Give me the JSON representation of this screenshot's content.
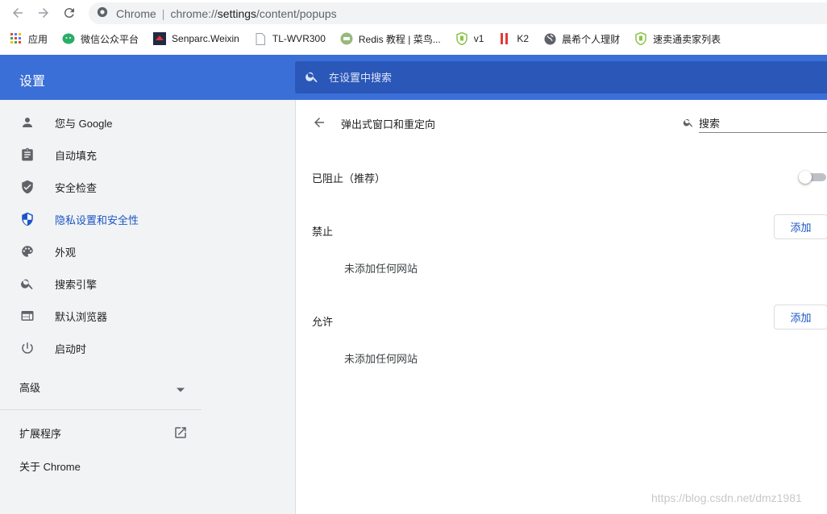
{
  "toolbar": {
    "back_icon": "arrow-left-icon",
    "forward_icon": "arrow-right-icon",
    "reload_icon": "reload-icon",
    "site_name": "Chrome",
    "url_prefix": "chrome://",
    "url_host": "settings",
    "url_path": "/content/popups"
  },
  "bookmarks": [
    {
      "label": "应用",
      "icon": "apps-grid-icon"
    },
    {
      "label": "微信公众平台",
      "icon": "wechat-icon"
    },
    {
      "label": "Senparc.Weixin",
      "icon": "senparc-icon"
    },
    {
      "label": "TL-WVR300",
      "icon": "page-icon"
    },
    {
      "label": "Redis 教程 | 菜鸟...",
      "icon": "runoob-icon"
    },
    {
      "label": "v1",
      "icon": "shield-green-icon"
    },
    {
      "label": "K2",
      "icon": "k2-icon"
    },
    {
      "label": "晨希个人理财",
      "icon": "globe-icon"
    },
    {
      "label": "速卖通卖家列表",
      "icon": "shield-green-icon"
    }
  ],
  "header": {
    "title": "设置",
    "search_placeholder": "在设置中搜索"
  },
  "sidebar": {
    "items": [
      {
        "label": "您与 Google",
        "icon": "person-icon"
      },
      {
        "label": "自动填充",
        "icon": "clipboard-icon"
      },
      {
        "label": "安全检查",
        "icon": "shield-check-icon"
      },
      {
        "label": "隐私设置和安全性",
        "icon": "shield-privacy-icon",
        "active": true
      },
      {
        "label": "外观",
        "icon": "palette-icon"
      },
      {
        "label": "搜索引擎",
        "icon": "search-icon"
      },
      {
        "label": "默认浏览器",
        "icon": "browser-window-icon"
      },
      {
        "label": "启动时",
        "icon": "power-icon"
      }
    ],
    "advanced_label": "高级",
    "extensions_label": "扩展程序",
    "about_label": "关于 Chrome"
  },
  "main": {
    "title": "弹出式窗口和重定向",
    "search_placeholder": "搜索",
    "blocked_label": "已阻止（推荐）",
    "blocked_enabled": false,
    "block_section_label": "禁止",
    "block_add_label": "添加",
    "block_empty_text": "未添加任何网站",
    "allow_section_label": "允许",
    "allow_add_label": "添加",
    "allow_empty_text": "未添加任何网站"
  },
  "watermark": "https://blog.csdn.net/dmz1981",
  "colors": {
    "header_blue": "#3b6fd8",
    "search_blue": "#2a57b8",
    "accent": "#1a56c4",
    "sidebar_bg": "#f1f3f4"
  }
}
